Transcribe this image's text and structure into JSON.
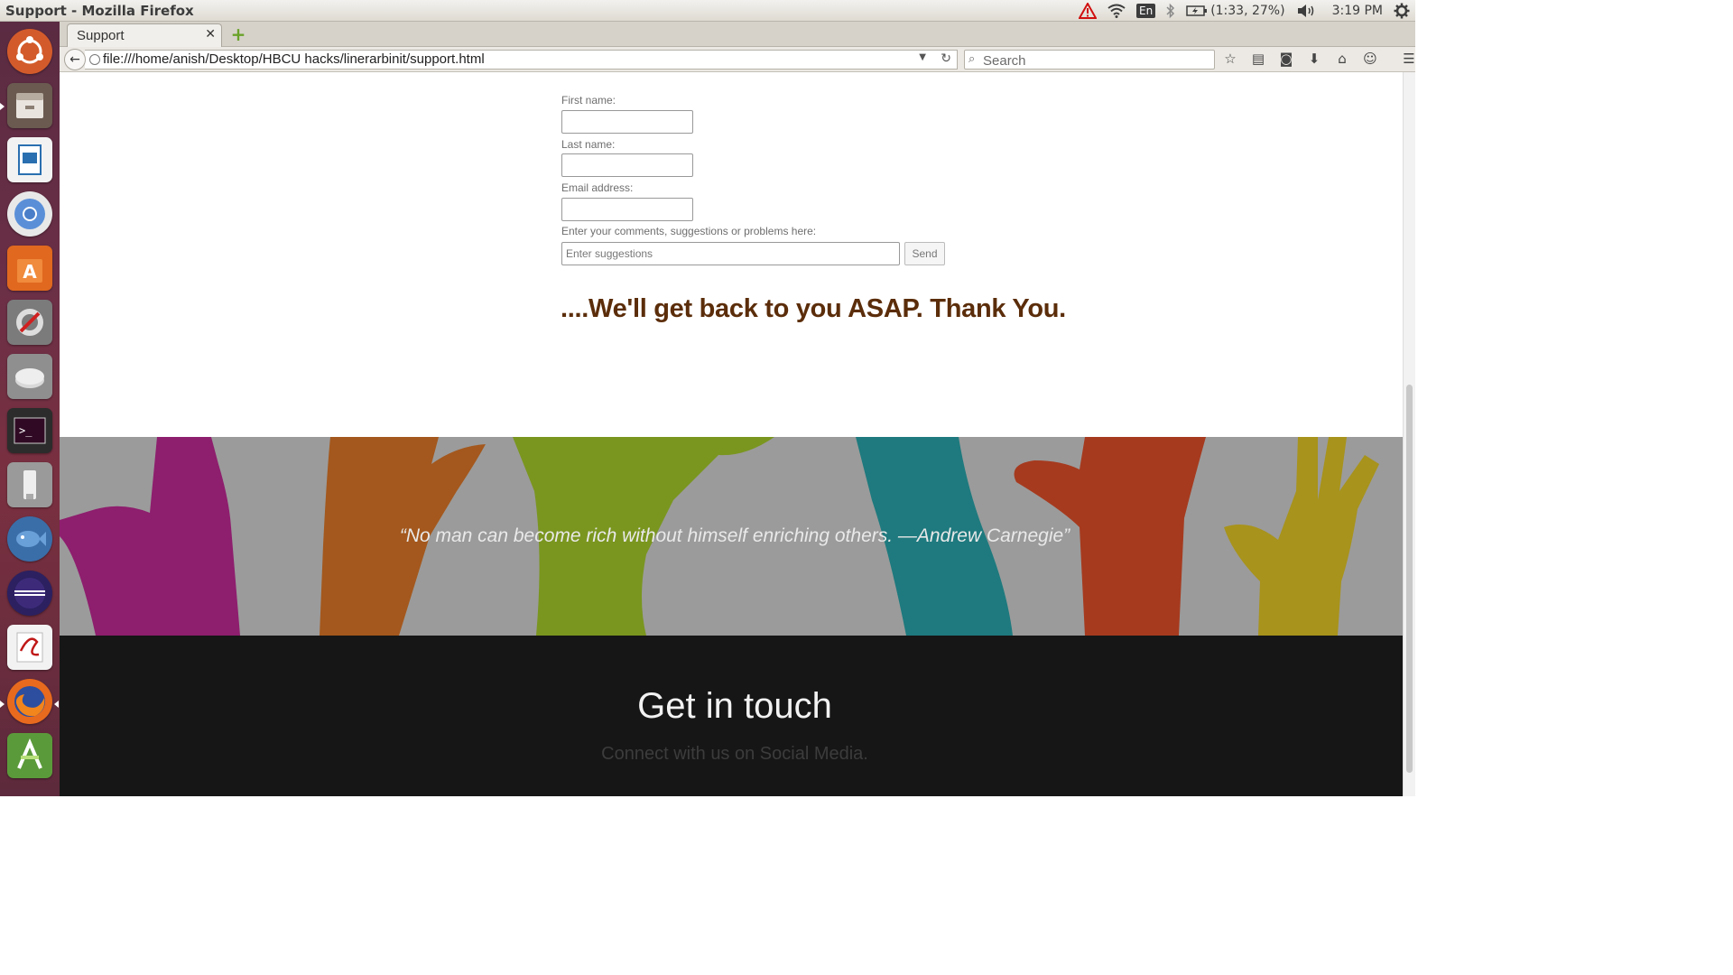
{
  "window": {
    "title": "Support - Mozilla Firefox"
  },
  "panel": {
    "keyboard_layout": "En",
    "battery": "(1:33, 27%)",
    "clock": "3:19 PM",
    "icons": [
      "warning-icon",
      "wifi-icon",
      "bluetooth-icon",
      "battery-icon",
      "volume-icon",
      "settings-gear-icon"
    ]
  },
  "launcher": {
    "items": [
      "ubuntu-dash",
      "files",
      "libreoffice-impress",
      "chromium",
      "software-center",
      "system-settings",
      "disk",
      "terminal",
      "usb-drive",
      "fish-app",
      "eclipse",
      "evince",
      "firefox",
      "android-studio"
    ]
  },
  "browser": {
    "tab_title": "Support",
    "url": "file:///home/anish/Desktop/HBCU hacks/linerarbinit/support.html",
    "search_placeholder": "Search"
  },
  "form": {
    "first_name_label": "First name:",
    "last_name_label": "Last name:",
    "email_label": "Email address:",
    "comments_label": "Enter your comments, suggestions or problems here:",
    "suggestions_placeholder": "Enter suggestions",
    "send_label": "Send",
    "thanks_text": "....We'll get back to you ASAP. Thank You."
  },
  "hero": {
    "quote": "“No man can become rich without himself enriching others. —Andrew Carnegie”"
  },
  "footer": {
    "title": "Get in touch",
    "subtitle": "Connect with us on Social Media."
  },
  "colors": {
    "thanks": "#5b2d0a",
    "hero_bg": "#9b9b9b",
    "footer_bg": "#161616",
    "launcher_bg": "#6b2f46"
  }
}
